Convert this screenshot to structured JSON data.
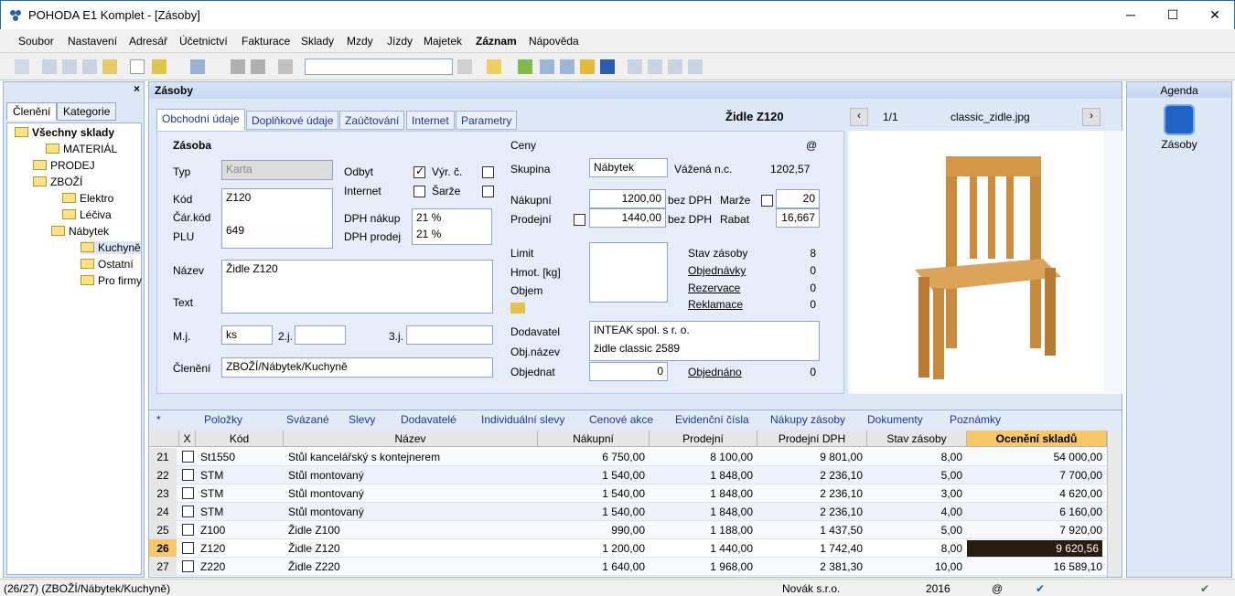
{
  "window": {
    "title": "POHODA E1 Komplet - [Zásoby]"
  },
  "menu": [
    "Soubor",
    "Nastavení",
    "Adresář",
    "Účetnictví",
    "Fakturace",
    "Sklady",
    "Mzdy",
    "Jízdy",
    "Majetek",
    "Záznam",
    "Nápověda"
  ],
  "left": {
    "tabs": [
      "Členění",
      "Kategorie"
    ],
    "tree": [
      "Všechny sklady",
      "MATERIÁL",
      "PRODEJ",
      "ZBOŽÍ",
      "Elektro",
      "Léčiva",
      "Nábytek",
      "Kuchyně",
      "Ostatní",
      "Pro firmy"
    ]
  },
  "main": {
    "title": "Zásoby",
    "tabs": [
      "Obchodní údaje",
      "Doplňkové údaje",
      "Zaúčtování",
      "Internet",
      "Parametry"
    ],
    "record_title": "Židle Z120",
    "form": {
      "section": "Zásoba",
      "typ_label": "Typ",
      "typ": "Karta",
      "kod_label": "Kód",
      "kod": "Z120",
      "carkod_label": "Čár.kód",
      "plu_label": "PLU",
      "plu": "649",
      "odbyt": "Odbyt",
      "vyrc": "Výr. č.",
      "internet": "Internet",
      "sarze": "Šarže",
      "dph_nakup_label": "DPH nákup",
      "dph_nakup": "21 %",
      "dph_prodej_label": "DPH prodej",
      "dph_prodej": "21 %",
      "nazev_label": "Název",
      "nazev": "Židle Z120",
      "text_label": "Text",
      "mj_label": "M.j.",
      "mj": "ks",
      "j2": "2.j.",
      "j3": "3.j.",
      "cleneni_label": "Členění",
      "cleneni": "ZBOŽÍ/Nábytek/Kuchyně"
    },
    "ceny": {
      "section": "Ceny",
      "at": "@",
      "skupina_label": "Skupina",
      "skupina": "Nábytek",
      "vazena_label": "Vážená n.c.",
      "vazena": "1202,57",
      "nakupni_label": "Nákupní",
      "nakupni": "1200,00",
      "bezdph1": "bez DPH",
      "marze_label": "Marže",
      "marze": "20",
      "prodejni_label": "Prodejní",
      "prodejni": "1440,00",
      "bezdph2": "bez DPH",
      "rabat_label": "Rabat",
      "rabat": "16,667",
      "limit": "Limit",
      "hmot": "Hmot. [kg]",
      "objem": "Objem",
      "stav_label": "Stav zásoby",
      "stav": "8",
      "objednavky_label": "Objednávky",
      "objednavky": "0",
      "rezervace_label": "Rezervace",
      "rezervace": "0",
      "reklamace_label": "Reklamace",
      "reklamace": "0",
      "dodavatel_label": "Dodavatel",
      "dodavatel": "INTEAK spol. s r. o.",
      "objnazev_label": "Obj.název",
      "objnazev": "židle classic 2589",
      "objednat_label": "Objednat",
      "objednat": "0",
      "objednano_label": "Objednáno",
      "objednano": "0"
    },
    "image": {
      "counter": "1/1",
      "filename": "classic_zidle.jpg"
    },
    "bottom_tabs": [
      "Položky",
      "Svázané",
      "Slevy",
      "Dodavatelé",
      "Individuální slevy",
      "Cenové akce",
      "Evidenční čísla",
      "Nákupy zásoby",
      "Dokumenty",
      "Poznámky"
    ],
    "grid": {
      "star": "*",
      "headers": [
        "X",
        "Kód",
        "Název",
        "Nákupní",
        "Prodejní",
        "Prodejní DPH",
        "Stav zásoby",
        "Ocenění skladů"
      ],
      "rows": [
        [
          "21",
          "St1550",
          "Stůl kancelářský s kontejnerem",
          "6 750,00",
          "8 100,00",
          "9 801,00",
          "8,00",
          "54 000,00"
        ],
        [
          "22",
          "STM",
          "Stůl montovaný",
          "1 540,00",
          "1 848,00",
          "2 236,10",
          "5,00",
          "7 700,00"
        ],
        [
          "23",
          "STM",
          "Stůl montovaný",
          "1 540,00",
          "1 848,00",
          "2 236,10",
          "3,00",
          "4 620,00"
        ],
        [
          "24",
          "STM",
          "Stůl montovaný",
          "1 540,00",
          "1 848,00",
          "2 236,10",
          "4,00",
          "6 160,00"
        ],
        [
          "25",
          "Z100",
          "Židle Z100",
          "990,00",
          "1 188,00",
          "1 437,50",
          "5,00",
          "7 920,00"
        ],
        [
          "26",
          "Z120",
          "Židle Z120",
          "1 200,00",
          "1 440,00",
          "1 742,40",
          "8,00",
          "9 620,56"
        ],
        [
          "27",
          "Z220",
          "Židle Z220",
          "1 640,00",
          "1 968,00",
          "2 381,30",
          "10,00",
          "16 589,10"
        ]
      ]
    }
  },
  "right": {
    "title": "Agenda",
    "item": "Zásoby"
  },
  "status": {
    "path": "(26/27) (ZBOŽÍ/Nábytek/Kuchyně)",
    "company": "Novák s.r.o.",
    "year": "2016",
    "at": "@"
  }
}
